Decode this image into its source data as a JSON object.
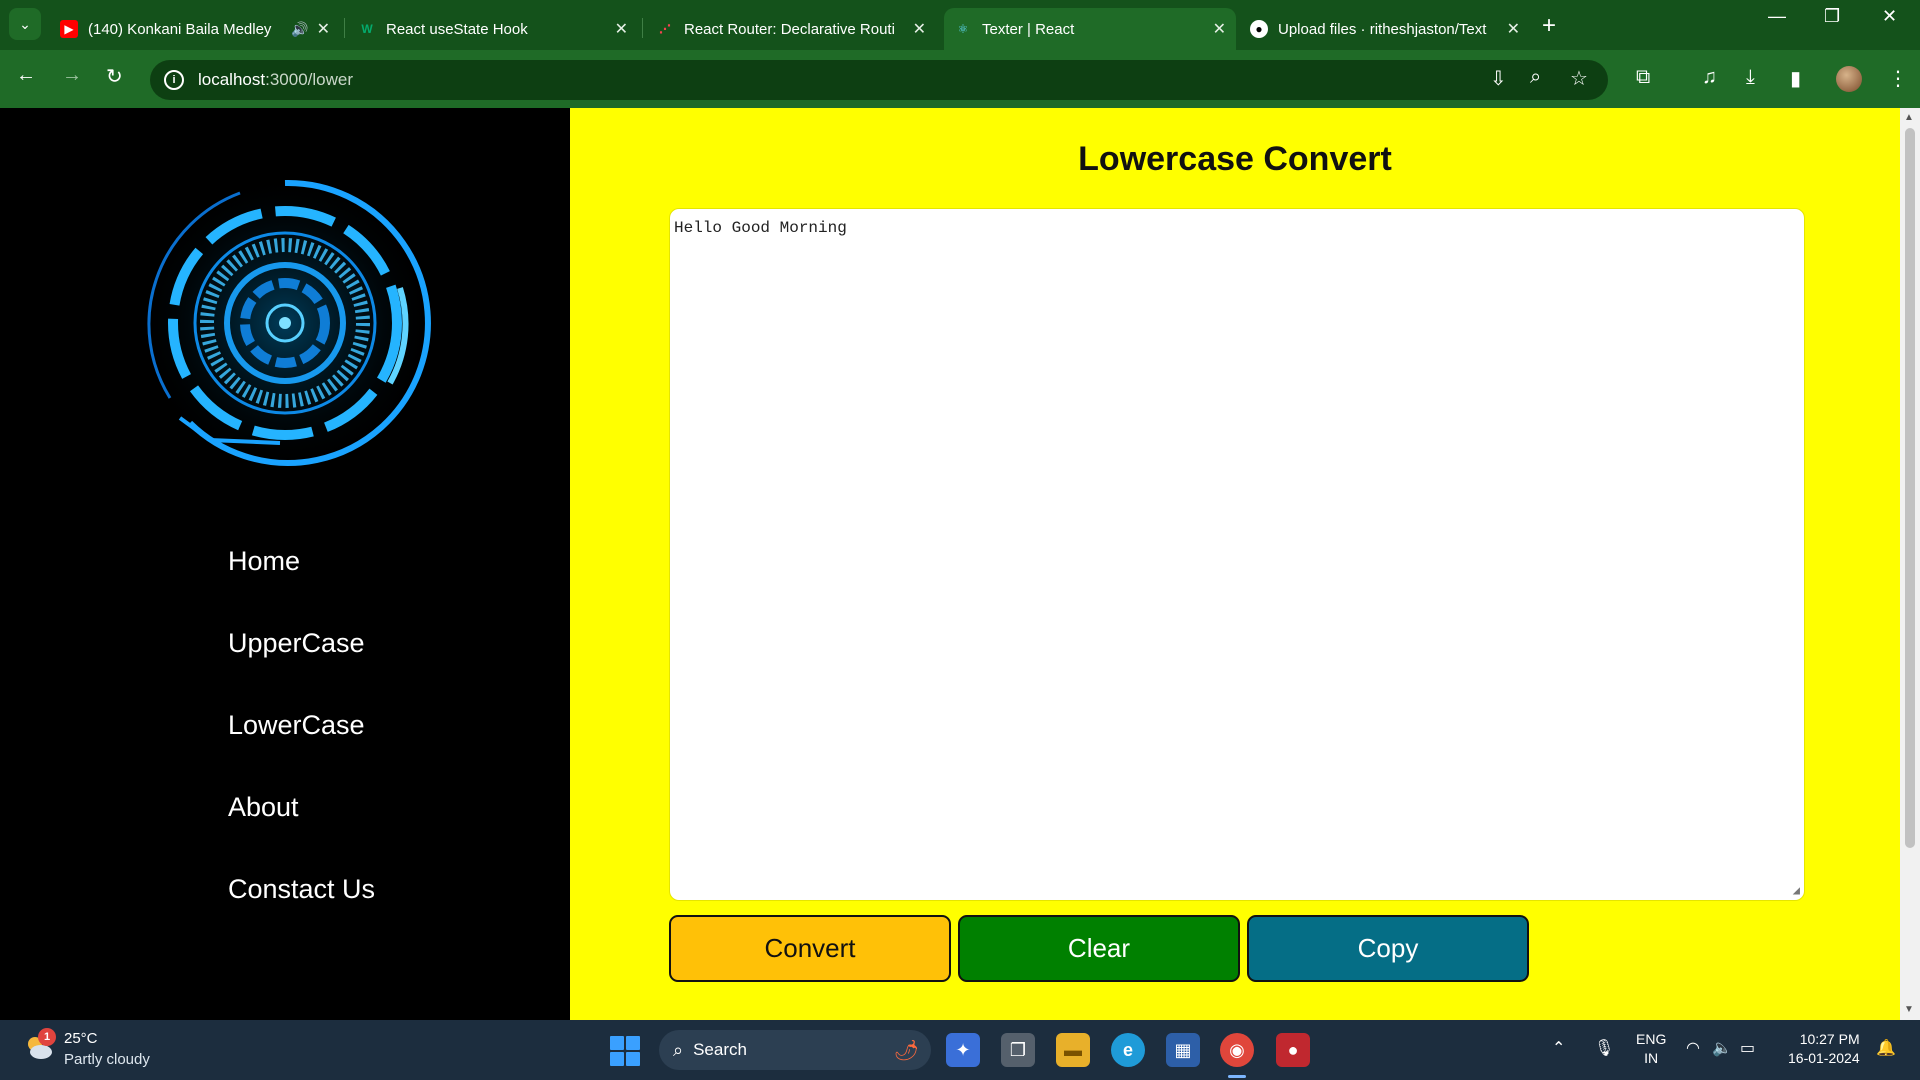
{
  "browser": {
    "tabs": [
      {
        "title": "(140) Konkani Baila Medley",
        "favicon": "youtube-icon",
        "audio": true,
        "active": false
      },
      {
        "title": "React useState Hook",
        "favicon": "w3schools-icon",
        "active": false
      },
      {
        "title": "React Router: Declarative Routi",
        "favicon": "react-router-icon",
        "active": false
      },
      {
        "title": "Texter | React",
        "favicon": "react-icon",
        "active": true
      },
      {
        "title": "Upload files · ritheshjaston/Text",
        "favicon": "github-icon",
        "active": false
      }
    ],
    "address": {
      "host": "localhost",
      "path": ":3000/lower"
    },
    "colors": {
      "frame": "#14521b",
      "toolbar": "#1f6b27"
    }
  },
  "sidebar": {
    "nav": [
      "Home",
      "UpperCase",
      "LowerCase",
      "About",
      "Constact Us"
    ]
  },
  "main": {
    "title": "Lowercase Convert",
    "textarea_value": "Hello Good Morning",
    "buttons": {
      "convert": "Convert",
      "clear": "Clear",
      "copy": "Copy"
    },
    "colors": {
      "background": "#ffff00",
      "convert": "#ffc107",
      "clear": "#008000",
      "copy": "#056e86"
    }
  },
  "taskbar": {
    "weather": {
      "temp": "25°C",
      "desc": "Partly cloudy",
      "badge": "1"
    },
    "search_label": "Search",
    "lang": {
      "line1": "ENG",
      "line2": "IN"
    },
    "clock": {
      "time": "10:27 PM",
      "date": "16-01-2024"
    }
  }
}
